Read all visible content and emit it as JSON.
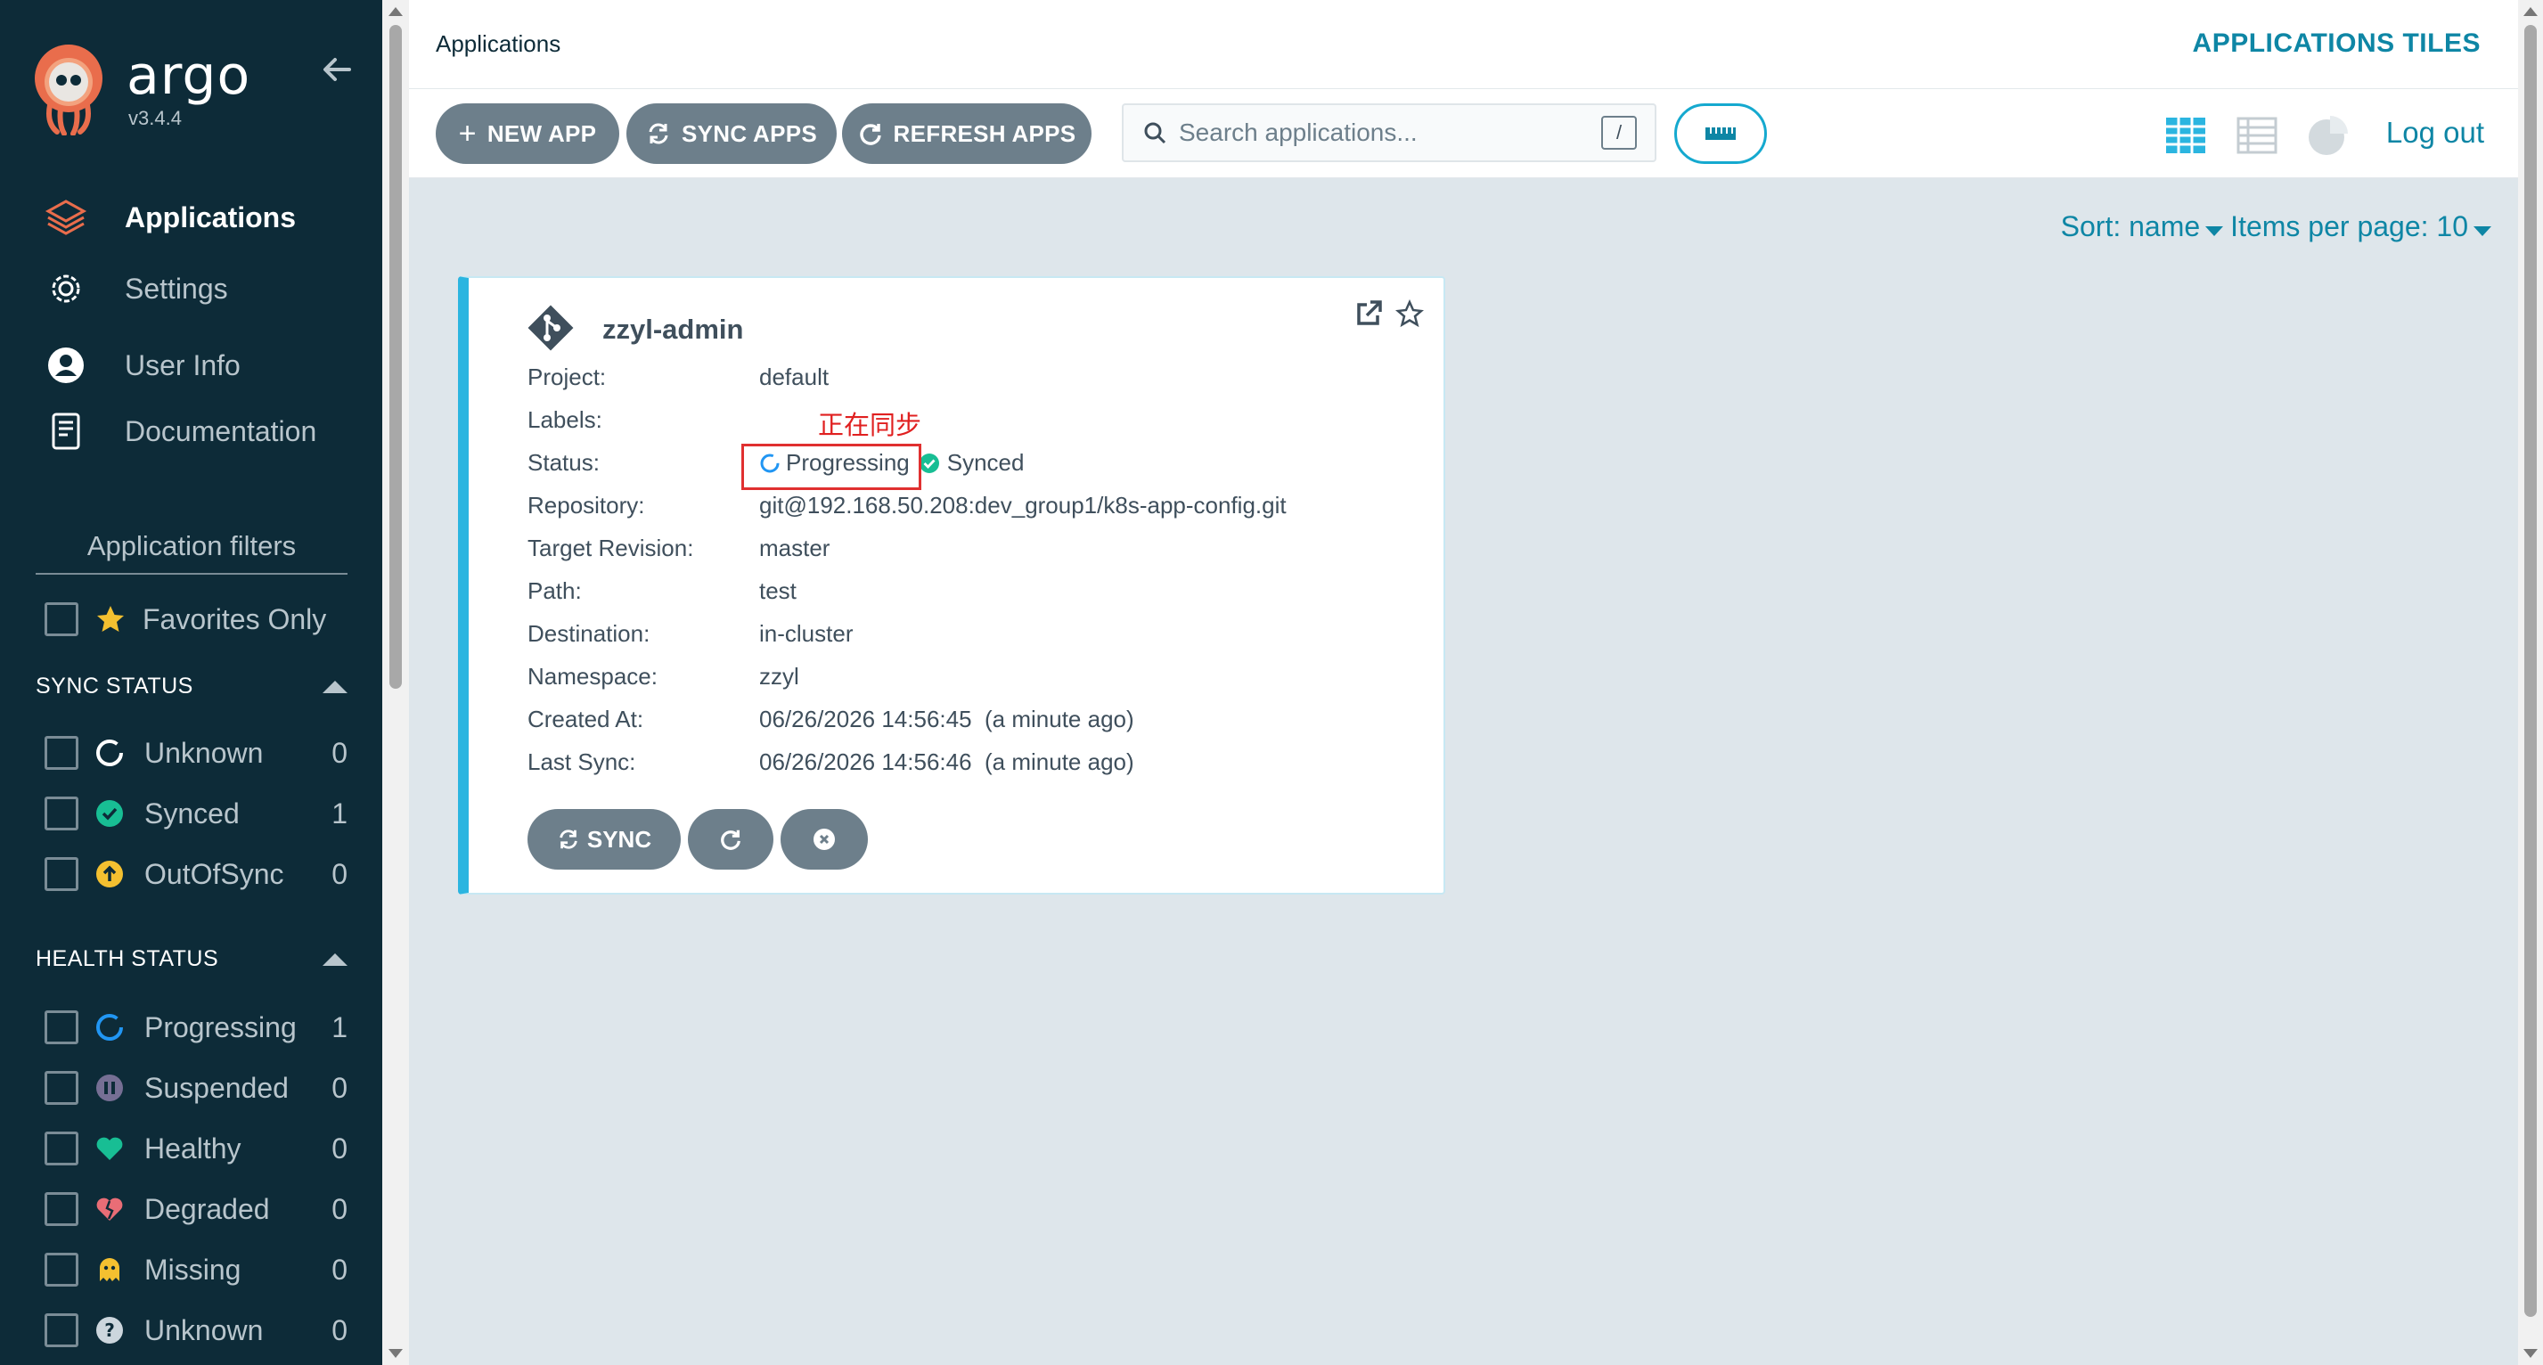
{
  "sidebar": {
    "brand": "argo",
    "version": "v3.4.4",
    "nav": [
      {
        "label": "Applications",
        "icon": "layers-icon"
      },
      {
        "label": "Settings",
        "icon": "gear-icon"
      },
      {
        "label": "User Info",
        "icon": "user-icon"
      },
      {
        "label": "Documentation",
        "icon": "book-icon"
      }
    ],
    "filters_title": "Application filters",
    "favorites_label": "Favorites Only",
    "sync_status": {
      "title": "SYNC STATUS",
      "items": [
        {
          "label": "Unknown",
          "count": "0"
        },
        {
          "label": "Synced",
          "count": "1"
        },
        {
          "label": "OutOfSync",
          "count": "0"
        }
      ]
    },
    "health_status": {
      "title": "HEALTH STATUS",
      "items": [
        {
          "label": "Progressing",
          "count": "1"
        },
        {
          "label": "Suspended",
          "count": "0"
        },
        {
          "label": "Healthy",
          "count": "0"
        },
        {
          "label": "Degraded",
          "count": "0"
        },
        {
          "label": "Missing",
          "count": "0"
        },
        {
          "label": "Unknown",
          "count": "0"
        }
      ]
    }
  },
  "topbar": {
    "breadcrumb": "Applications",
    "view_title": "APPLICATIONS TILES",
    "logout": "Log out"
  },
  "toolbar": {
    "new_app": "NEW APP",
    "sync_apps": "SYNC APPS",
    "refresh_apps": "REFRESH APPS",
    "search_placeholder": "Search applications...",
    "search_shortcut": "/"
  },
  "sort": {
    "sort_label": "Sort: name",
    "items_per_page": "Items per page: 10"
  },
  "app_card": {
    "name": "zzyl-admin",
    "annotation": "正在同步",
    "fields": {
      "project_k": "Project:",
      "project_v": "default",
      "labels_k": "Labels:",
      "labels_v": "",
      "status_k": "Status:",
      "health": "Progressing",
      "sync": "Synced",
      "repo_k": "Repository:",
      "repo_v": "git@192.168.50.208:dev_group1/k8s-app-config.git",
      "rev_k": "Target Revision:",
      "rev_v": "master",
      "path_k": "Path:",
      "path_v": "test",
      "dest_k": "Destination:",
      "dest_v": "in-cluster",
      "ns_k": "Namespace:",
      "ns_v": "zzyl",
      "created_k": "Created At:",
      "created_v": "06/26/2026 14:56:45  (a minute ago)",
      "lastsync_k": "Last Sync:",
      "lastsync_v": "06/26/2026 14:56:46  (a minute ago)"
    },
    "sync_button": "SYNC"
  },
  "colors": {
    "sidebar_bg": "#0d2b38",
    "accent": "#0e86a5",
    "progressing": "#2196f3",
    "synced": "#18be94",
    "outofsync": "#f4c030",
    "suspended": "#766f94",
    "degraded": "#e96d76",
    "annotation": "#e02020"
  }
}
